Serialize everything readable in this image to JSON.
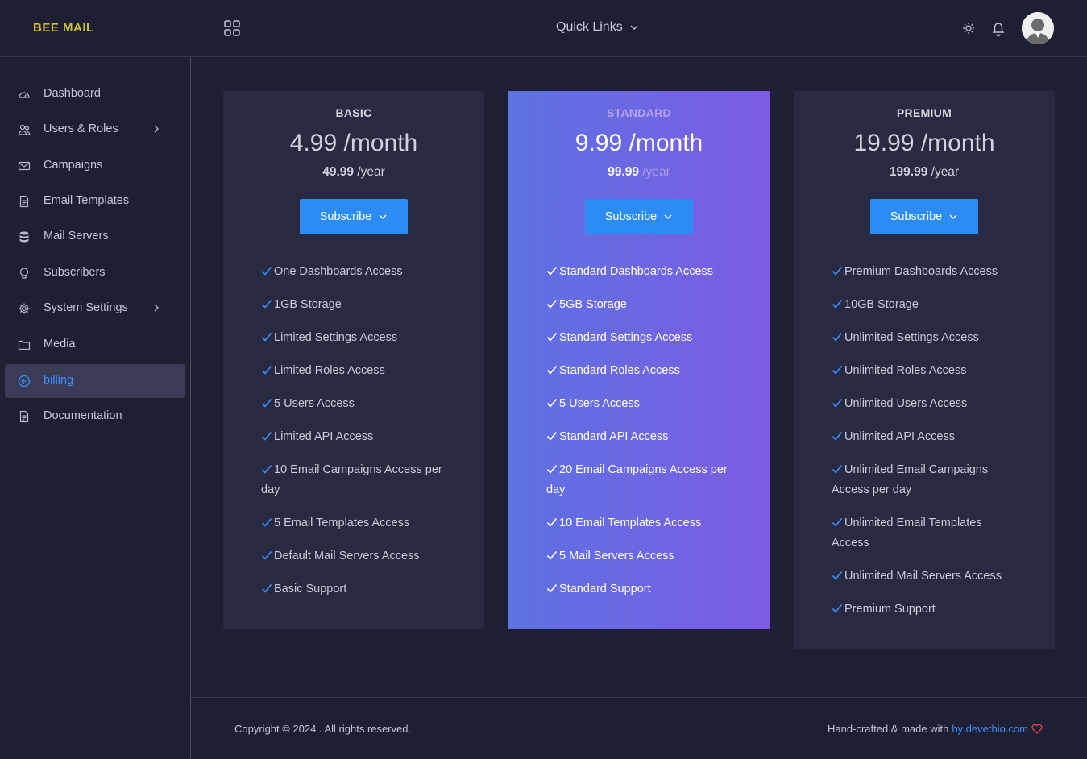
{
  "brand": "BEE MAIL",
  "header": {
    "quick_links": "Quick Links"
  },
  "sidebar": {
    "items": [
      {
        "label": "Dashboard",
        "icon": "dashboard-icon"
      },
      {
        "label": "Users & Roles",
        "icon": "users-icon",
        "has_submenu": true
      },
      {
        "label": "Campaigns",
        "icon": "envelope-icon"
      },
      {
        "label": "Email Templates",
        "icon": "document-icon"
      },
      {
        "label": "Mail Servers",
        "icon": "database-icon"
      },
      {
        "label": "Subscribers",
        "icon": "lightbulb-icon"
      },
      {
        "label": "System Settings",
        "icon": "gear-icon",
        "has_submenu": true
      },
      {
        "label": "Media",
        "icon": "folder-icon"
      },
      {
        "label": "billing",
        "icon": "billing-icon",
        "active": true
      },
      {
        "label": "Documentation",
        "icon": "document-icon"
      }
    ]
  },
  "plans": [
    {
      "name": "BASIC",
      "monthly": "4.99 /month",
      "yearly_value": "49.99",
      "yearly_unit": " /year",
      "button": "Subscribe",
      "features": [
        "One Dashboards Access",
        "1GB Storage",
        "Limited Settings Access",
        "Limited Roles Access",
        "5 Users Access",
        "Limited API Access",
        "10 Email Campaigns Access per day",
        "5 Email Templates Access",
        "Default Mail Servers Access",
        "Basic Support"
      ]
    },
    {
      "name": "STANDARD",
      "monthly": "9.99 /month",
      "yearly_value": "99.99",
      "yearly_unit": " /year",
      "button": "Subscribe",
      "features": [
        "Standard Dashboards Access",
        "5GB Storage",
        "Standard Settings Access",
        "Standard Roles Access",
        "5 Users Access",
        "Standard API Access",
        "20 Email Campaigns Access per day",
        "10 Email Templates Access",
        "5 Mail Servers Access",
        "Standard Support"
      ]
    },
    {
      "name": "PREMIUM",
      "monthly": "19.99 /month",
      "yearly_value": "199.99",
      "yearly_unit": " /year",
      "button": "Subscribe",
      "features": [
        "Premium Dashboards Access",
        "10GB Storage",
        "Unlimited Settings Access",
        "Unlimited Roles Access",
        "Unlimited Users Access",
        "Unlimited API Access",
        "Unlimited Email Campaigns Access per day",
        "Unlimited Email Templates Access",
        "Unlimited Mail Servers Access",
        "Premium Support"
      ]
    }
  ],
  "footer": {
    "copyright": "Copyright © 2024 . All rights reserved.",
    "credits_prefix": "Hand-crafted & made with",
    "credits_link": "by devethio.com"
  },
  "colors": {
    "background": "#1e1f33",
    "card": "#272a40",
    "accent": "#2c8cf4",
    "standard_gradient_start": "#5d72e3",
    "standard_gradient_end": "#7c5ce2",
    "brand_gold": "#e0b531",
    "heart": "#e8405a"
  }
}
